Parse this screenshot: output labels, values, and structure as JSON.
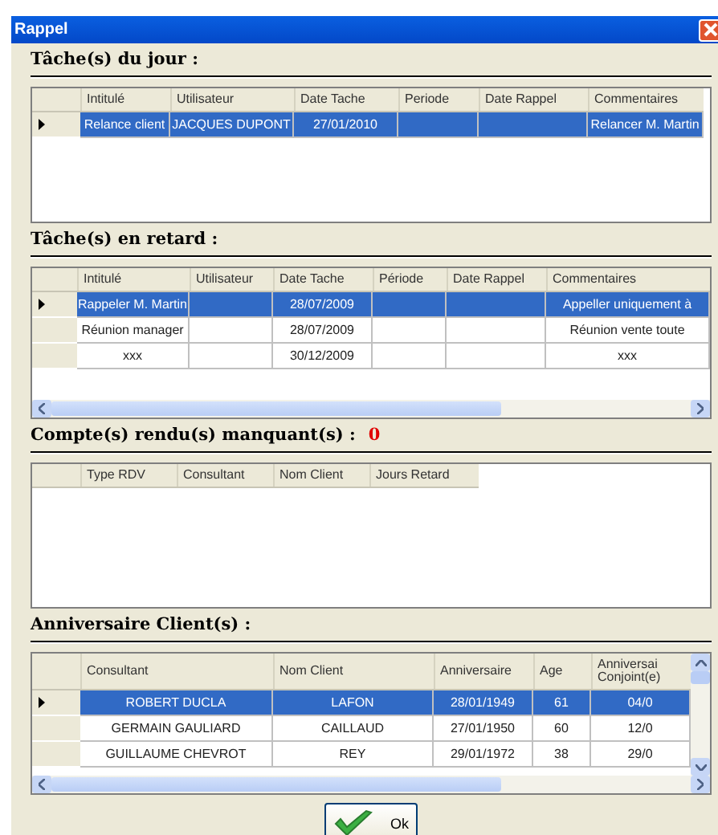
{
  "window": {
    "title": "Rappel"
  },
  "sections": [
    {
      "title": "Tâche(s) du jour :",
      "horizontal_scroll": false,
      "vertical_scroll": false,
      "columns": [
        "Intitulé",
        "Utilisateur",
        "Date Tache",
        "Periode",
        "Date Rappel",
        "Commentaires"
      ],
      "rows": [
        {
          "selected": true,
          "cells": [
            "Relance client",
            "JACQUES DUPONT",
            "27/01/2010",
            "",
            "",
            "Relancer M. Martin"
          ]
        }
      ]
    },
    {
      "title": "Tâche(s) en retard :",
      "horizontal_scroll": true,
      "vertical_scroll": false,
      "columns": [
        "Intitulé",
        "Utilisateur",
        "Date Tache",
        "Période",
        "Date Rappel",
        "Commentaires"
      ],
      "rows": [
        {
          "selected": true,
          "cells": [
            "Rappeler M. Martin",
            "",
            "28/07/2009",
            "",
            "",
            "Appeller uniquement à"
          ]
        },
        {
          "selected": false,
          "cells": [
            "Réunion manager",
            "",
            "28/07/2009",
            "",
            "",
            "Réunion vente toute"
          ]
        },
        {
          "selected": false,
          "cells": [
            "xxx",
            "",
            "30/12/2009",
            "",
            "",
            "xxx"
          ]
        }
      ]
    },
    {
      "title": "Compte(s) rendu(s) manquant(s) :",
      "count": "0",
      "horizontal_scroll": false,
      "vertical_scroll": false,
      "columns": [
        "Type RDV",
        "Consultant",
        "Nom Client",
        "Jours Retard"
      ]
    },
    {
      "title": "Anniversaire Client(s) :",
      "horizontal_scroll": true,
      "vertical_scroll": true,
      "columns": [
        "Consultant",
        "Nom Client",
        "Anniversaire",
        "Age",
        "Anniversai Conjoint(e)"
      ],
      "rows": [
        {
          "selected": true,
          "cells": [
            "ROBERT DUCLA",
            "LAFON",
            "28/01/1949",
            "61",
            "04/0"
          ]
        },
        {
          "selected": false,
          "cells": [
            "GERMAIN GAULIARD",
            "CAILLAUD",
            "27/01/1950",
            "60",
            "12/0"
          ]
        },
        {
          "selected": false,
          "cells": [
            "GUILLAUME CHEVROT",
            "REY",
            "29/01/1972",
            "38",
            "29/0"
          ]
        }
      ]
    }
  ],
  "ok_button": {
    "label": "Ok"
  }
}
